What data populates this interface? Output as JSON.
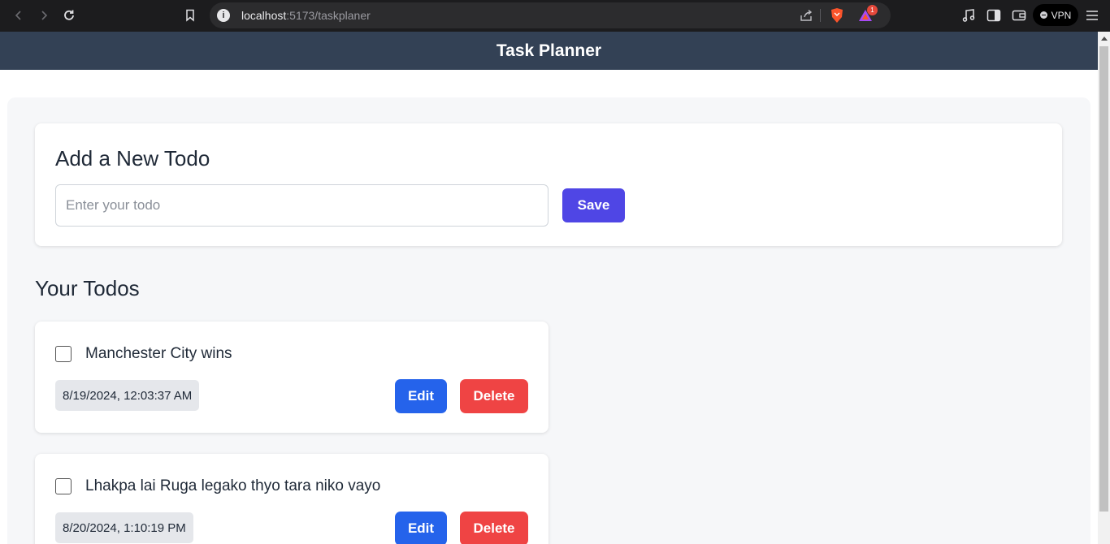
{
  "browser": {
    "url_host": "localhost",
    "url_path": ":5173/taskplaner",
    "notification_count": "1",
    "vpn_label": "VPN"
  },
  "header": {
    "title": "Task Planner"
  },
  "add_todo": {
    "title": "Add a New Todo",
    "input_placeholder": "Enter your todo",
    "input_value": "",
    "save_label": "Save"
  },
  "todos_section": {
    "title": "Your Todos",
    "edit_label": "Edit",
    "delete_label": "Delete",
    "items": [
      {
        "text": "Manchester City wins",
        "date": "8/19/2024, 12:03:37 AM",
        "completed": false
      },
      {
        "text": "Lhakpa lai Ruga legako thyo tara niko vayo",
        "date": "8/20/2024, 1:10:19 PM",
        "completed": false
      }
    ]
  },
  "colors": {
    "header_bg": "#334155",
    "save_button": "#4f46e5",
    "edit_button": "#2563eb",
    "delete_button": "#ef4444"
  }
}
